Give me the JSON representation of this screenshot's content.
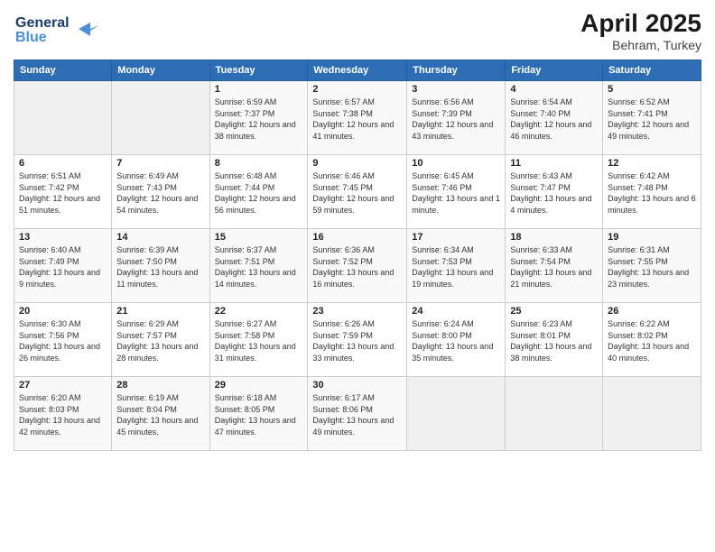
{
  "header": {
    "logo_line1": "General",
    "logo_line2": "Blue",
    "title": "April 2025",
    "location": "Behram, Turkey"
  },
  "days_of_week": [
    "Sunday",
    "Monday",
    "Tuesday",
    "Wednesday",
    "Thursday",
    "Friday",
    "Saturday"
  ],
  "weeks": [
    [
      {
        "day": "",
        "info": ""
      },
      {
        "day": "",
        "info": ""
      },
      {
        "day": "1",
        "info": "Sunrise: 6:59 AM\nSunset: 7:37 PM\nDaylight: 12 hours and 38 minutes."
      },
      {
        "day": "2",
        "info": "Sunrise: 6:57 AM\nSunset: 7:38 PM\nDaylight: 12 hours and 41 minutes."
      },
      {
        "day": "3",
        "info": "Sunrise: 6:56 AM\nSunset: 7:39 PM\nDaylight: 12 hours and 43 minutes."
      },
      {
        "day": "4",
        "info": "Sunrise: 6:54 AM\nSunset: 7:40 PM\nDaylight: 12 hours and 46 minutes."
      },
      {
        "day": "5",
        "info": "Sunrise: 6:52 AM\nSunset: 7:41 PM\nDaylight: 12 hours and 49 minutes."
      }
    ],
    [
      {
        "day": "6",
        "info": "Sunrise: 6:51 AM\nSunset: 7:42 PM\nDaylight: 12 hours and 51 minutes."
      },
      {
        "day": "7",
        "info": "Sunrise: 6:49 AM\nSunset: 7:43 PM\nDaylight: 12 hours and 54 minutes."
      },
      {
        "day": "8",
        "info": "Sunrise: 6:48 AM\nSunset: 7:44 PM\nDaylight: 12 hours and 56 minutes."
      },
      {
        "day": "9",
        "info": "Sunrise: 6:46 AM\nSunset: 7:45 PM\nDaylight: 12 hours and 59 minutes."
      },
      {
        "day": "10",
        "info": "Sunrise: 6:45 AM\nSunset: 7:46 PM\nDaylight: 13 hours and 1 minute."
      },
      {
        "day": "11",
        "info": "Sunrise: 6:43 AM\nSunset: 7:47 PM\nDaylight: 13 hours and 4 minutes."
      },
      {
        "day": "12",
        "info": "Sunrise: 6:42 AM\nSunset: 7:48 PM\nDaylight: 13 hours and 6 minutes."
      }
    ],
    [
      {
        "day": "13",
        "info": "Sunrise: 6:40 AM\nSunset: 7:49 PM\nDaylight: 13 hours and 9 minutes."
      },
      {
        "day": "14",
        "info": "Sunrise: 6:39 AM\nSunset: 7:50 PM\nDaylight: 13 hours and 11 minutes."
      },
      {
        "day": "15",
        "info": "Sunrise: 6:37 AM\nSunset: 7:51 PM\nDaylight: 13 hours and 14 minutes."
      },
      {
        "day": "16",
        "info": "Sunrise: 6:36 AM\nSunset: 7:52 PM\nDaylight: 13 hours and 16 minutes."
      },
      {
        "day": "17",
        "info": "Sunrise: 6:34 AM\nSunset: 7:53 PM\nDaylight: 13 hours and 19 minutes."
      },
      {
        "day": "18",
        "info": "Sunrise: 6:33 AM\nSunset: 7:54 PM\nDaylight: 13 hours and 21 minutes."
      },
      {
        "day": "19",
        "info": "Sunrise: 6:31 AM\nSunset: 7:55 PM\nDaylight: 13 hours and 23 minutes."
      }
    ],
    [
      {
        "day": "20",
        "info": "Sunrise: 6:30 AM\nSunset: 7:56 PM\nDaylight: 13 hours and 26 minutes."
      },
      {
        "day": "21",
        "info": "Sunrise: 6:29 AM\nSunset: 7:57 PM\nDaylight: 13 hours and 28 minutes."
      },
      {
        "day": "22",
        "info": "Sunrise: 6:27 AM\nSunset: 7:58 PM\nDaylight: 13 hours and 31 minutes."
      },
      {
        "day": "23",
        "info": "Sunrise: 6:26 AM\nSunset: 7:59 PM\nDaylight: 13 hours and 33 minutes."
      },
      {
        "day": "24",
        "info": "Sunrise: 6:24 AM\nSunset: 8:00 PM\nDaylight: 13 hours and 35 minutes."
      },
      {
        "day": "25",
        "info": "Sunrise: 6:23 AM\nSunset: 8:01 PM\nDaylight: 13 hours and 38 minutes."
      },
      {
        "day": "26",
        "info": "Sunrise: 6:22 AM\nSunset: 8:02 PM\nDaylight: 13 hours and 40 minutes."
      }
    ],
    [
      {
        "day": "27",
        "info": "Sunrise: 6:20 AM\nSunset: 8:03 PM\nDaylight: 13 hours and 42 minutes."
      },
      {
        "day": "28",
        "info": "Sunrise: 6:19 AM\nSunset: 8:04 PM\nDaylight: 13 hours and 45 minutes."
      },
      {
        "day": "29",
        "info": "Sunrise: 6:18 AM\nSunset: 8:05 PM\nDaylight: 13 hours and 47 minutes."
      },
      {
        "day": "30",
        "info": "Sunrise: 6:17 AM\nSunset: 8:06 PM\nDaylight: 13 hours and 49 minutes."
      },
      {
        "day": "",
        "info": ""
      },
      {
        "day": "",
        "info": ""
      },
      {
        "day": "",
        "info": ""
      }
    ]
  ]
}
